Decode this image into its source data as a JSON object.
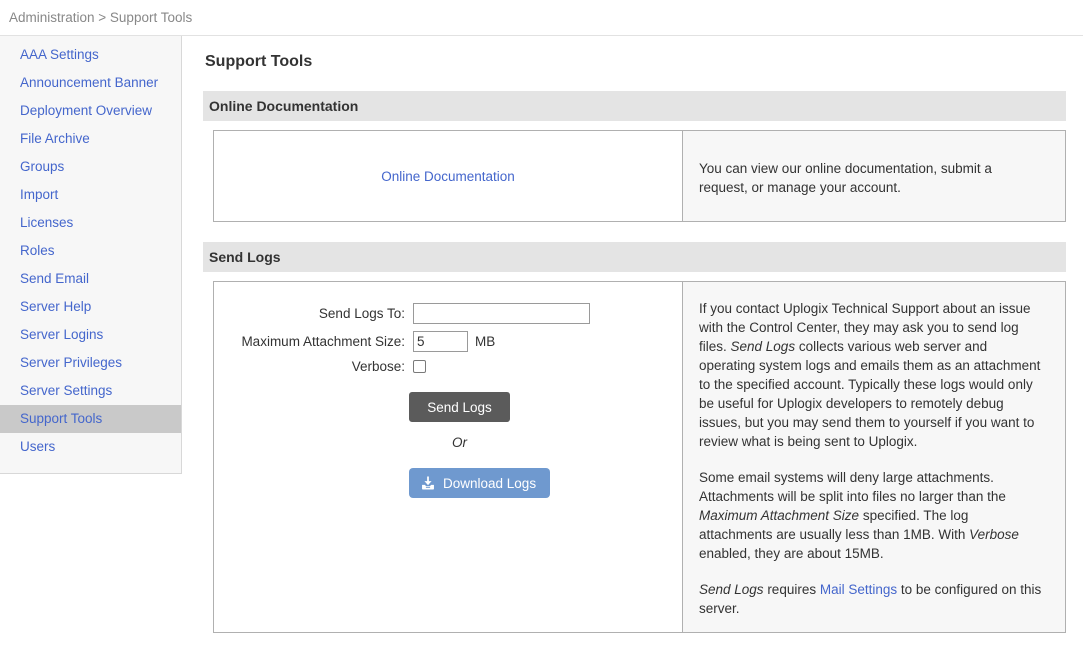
{
  "breadcrumb": {
    "text": "Administration > Support Tools"
  },
  "sidebar": {
    "items": [
      {
        "label": "AAA Settings",
        "active": false
      },
      {
        "label": "Announcement Banner",
        "active": false
      },
      {
        "label": "Deployment Overview",
        "active": false
      },
      {
        "label": "File Archive",
        "active": false
      },
      {
        "label": "Groups",
        "active": false
      },
      {
        "label": "Import",
        "active": false
      },
      {
        "label": "Licenses",
        "active": false
      },
      {
        "label": "Roles",
        "active": false
      },
      {
        "label": "Send Email",
        "active": false
      },
      {
        "label": "Server Help",
        "active": false
      },
      {
        "label": "Server Logins",
        "active": false
      },
      {
        "label": "Server Privileges",
        "active": false
      },
      {
        "label": "Server Settings",
        "active": false
      },
      {
        "label": "Support Tools",
        "active": true
      },
      {
        "label": "Users",
        "active": false
      }
    ]
  },
  "main": {
    "page_title": "Support Tools",
    "online_documentation": {
      "section_title": "Online Documentation",
      "link_label": "Online Documentation",
      "description": "You can view our online documentation, submit a request, or manage your account."
    },
    "send_logs": {
      "section_title": "Send Logs",
      "fields": {
        "send_logs_to_label": "Send Logs To:",
        "send_logs_to_value": "",
        "max_attachment_label": "Maximum Attachment Size:",
        "max_attachment_value": "5",
        "max_attachment_unit": "MB",
        "verbose_label": "Verbose:",
        "verbose_checked": false
      },
      "send_button_label": "Send Logs",
      "or_label": "Or",
      "download_button_label": "Download Logs",
      "help": {
        "para1_a": "If you contact Uplogix Technical Support about an issue with the Control Center, they may ask you to send log files. ",
        "para1_em": "Send Logs",
        "para1_b": " collects various web server and operating system logs and emails them as an attachment to the specified account. Typically these logs would only be useful for Uplogix developers to remotely debug issues, but you may send them to yourself if you want to review what is being sent to Uplogix.",
        "para2_a": "Some email systems will deny large attachments. Attachments will be split into files no larger than the ",
        "para2_em1": "Maximum Attachment Size",
        "para2_b": " specified. The log attachments are usually less than 1MB. With ",
        "para2_em2": "Verbose",
        "para2_c": " enabled, they are about 15MB.",
        "para3_em": "Send Logs",
        "para3_a": " requires ",
        "para3_link": "Mail Settings",
        "para3_b": " to be configured on this server."
      }
    }
  },
  "colors": {
    "link": "#4466cc",
    "section_header_bg": "#e4e4e4",
    "active_nav_bg": "#c9c9c9",
    "send_button_bg": "#5b5b5b",
    "download_button_bg": "#6f99cf",
    "panel_border": "#b0b0b0"
  }
}
